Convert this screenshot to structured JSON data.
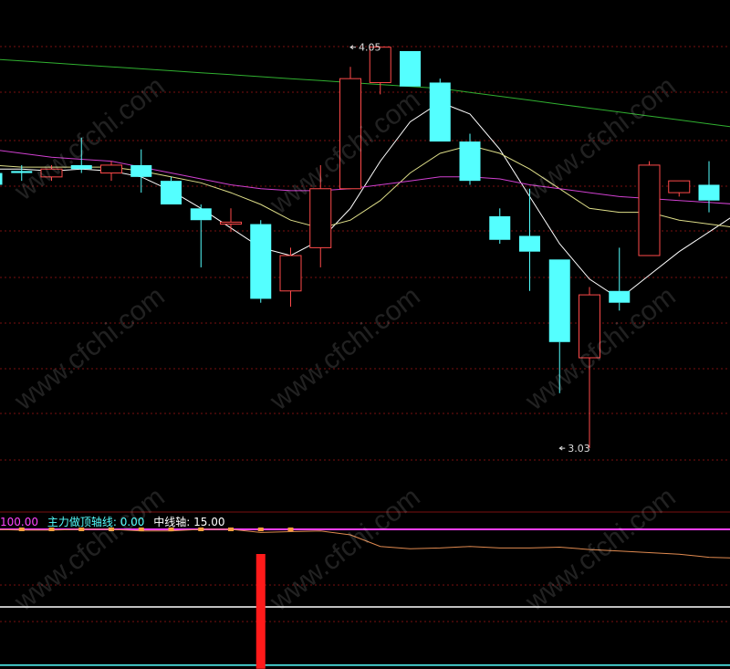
{
  "colors": {
    "background": "#000000",
    "grid": "#7a1010",
    "up_candle": "#ff4a4a",
    "down_candle": "#54ffff",
    "ma_white": "#ffffff",
    "ma_yellow": "#dddd88",
    "ma_magenta": "#d040d0",
    "ma_green": "#30b030",
    "legend_pink": "#ff44ff",
    "legend_cyan": "#54ffff",
    "legend_white": "#ffffff",
    "indicator_line": "#e08a50",
    "indicator_bar": "#ff1a1a",
    "indicator_dots": "#ffa040",
    "hline_magenta": "#ff40ff",
    "hline_white": "#ffffff",
    "hline_cyan": "#54ffff"
  },
  "watermarks": [
    "www.cfchi.com",
    "www.cfchi.com",
    "www.cfchi.com",
    "www.cfchi.com",
    "www.cfchi.com",
    "www.cfchi.com",
    "www.cfchi.com",
    "www.cfchi.com",
    "www.cfchi.com"
  ],
  "indicator_legend": {
    "first_value": "100.00",
    "top_axis_name": "主力做顶轴线:",
    "top_axis_value": "0.00",
    "mid_axis_name": "中线轴:",
    "mid_axis_value": "15.00"
  },
  "chart_data": [
    {
      "type": "candlestick",
      "ylim": [
        2.87,
        4.17
      ],
      "grid": true,
      "annotations": [
        {
          "text": "4.05",
          "bar_index": 12,
          "value": 4.05
        },
        {
          "text": "3.03",
          "bar_index": 19,
          "value": 3.03
        }
      ],
      "candles": [
        {
          "open": 3.73,
          "close": 3.7,
          "high": 3.74,
          "low": 3.69
        },
        {
          "open": 3.735,
          "close": 3.73,
          "high": 3.75,
          "low": 3.71
        },
        {
          "open": 3.72,
          "close": 3.74,
          "high": 3.75,
          "low": 3.71
        },
        {
          "open": 3.75,
          "close": 3.74,
          "high": 3.82,
          "low": 3.73
        },
        {
          "open": 3.73,
          "close": 3.75,
          "high": 3.76,
          "low": 3.71
        },
        {
          "open": 3.75,
          "close": 3.72,
          "high": 3.79,
          "low": 3.68
        },
        {
          "open": 3.71,
          "close": 3.65,
          "high": 3.72,
          "low": 3.65
        },
        {
          "open": 3.64,
          "close": 3.61,
          "high": 3.65,
          "low": 3.49
        },
        {
          "open": 3.6,
          "close": 3.605,
          "high": 3.64,
          "low": 3.58
        },
        {
          "open": 3.6,
          "close": 3.41,
          "high": 3.61,
          "low": 3.4
        },
        {
          "open": 3.43,
          "close": 3.52,
          "high": 3.54,
          "low": 3.39
        },
        {
          "open": 3.54,
          "close": 3.69,
          "high": 3.75,
          "low": 3.49
        },
        {
          "open": 3.69,
          "close": 3.97,
          "high": 4.0,
          "low": 3.69
        },
        {
          "open": 3.96,
          "close": 4.05,
          "high": 4.05,
          "low": 3.93
        },
        {
          "open": 4.04,
          "close": 3.95,
          "high": 4.04,
          "low": 3.95
        },
        {
          "open": 3.96,
          "close": 3.81,
          "high": 3.97,
          "low": 3.81
        },
        {
          "open": 3.81,
          "close": 3.71,
          "high": 3.83,
          "low": 3.7
        },
        {
          "open": 3.62,
          "close": 3.56,
          "high": 3.64,
          "low": 3.55
        },
        {
          "open": 3.57,
          "close": 3.53,
          "high": 3.69,
          "low": 3.43
        },
        {
          "open": 3.51,
          "close": 3.3,
          "high": 3.51,
          "low": 3.17
        },
        {
          "open": 3.26,
          "close": 3.42,
          "high": 3.44,
          "low": 3.03
        },
        {
          "open": 3.43,
          "close": 3.4,
          "high": 3.54,
          "low": 3.38
        },
        {
          "open": 3.52,
          "close": 3.75,
          "high": 3.76,
          "low": 3.52
        },
        {
          "open": 3.68,
          "close": 3.71,
          "high": 3.71,
          "low": 3.67
        },
        {
          "open": 3.7,
          "close": 3.66,
          "high": 3.76,
          "low": 3.63
        }
      ],
      "series": [
        {
          "values": [
            3.74,
            3.74,
            3.735,
            3.74,
            3.735,
            3.72,
            3.685,
            3.64,
            3.59,
            3.54,
            3.52,
            3.56,
            3.64,
            3.76,
            3.86,
            3.91,
            3.88,
            3.79,
            3.67,
            3.55,
            3.46,
            3.41,
            3.47,
            3.53,
            3.58
          ]
        },
        {
          "values": [
            3.75,
            3.745,
            3.745,
            3.745,
            3.745,
            3.735,
            3.72,
            3.705,
            3.68,
            3.65,
            3.61,
            3.59,
            3.61,
            3.66,
            3.73,
            3.78,
            3.8,
            3.78,
            3.74,
            3.69,
            3.64,
            3.63,
            3.63,
            3.61,
            3.6
          ]
        },
        {
          "values": [
            3.79,
            3.78,
            3.77,
            3.765,
            3.76,
            3.745,
            3.73,
            3.715,
            3.7,
            3.69,
            3.685,
            3.685,
            3.69,
            3.7,
            3.71,
            3.72,
            3.72,
            3.715,
            3.7,
            3.69,
            3.68,
            3.67,
            3.665,
            3.66,
            3.655
          ]
        },
        {
          "values": [
            4.02,
            4.015,
            4.01,
            4.005,
            4.0,
            3.995,
            3.99,
            3.985,
            3.98,
            3.975,
            3.97,
            3.965,
            3.96,
            3.955,
            3.95,
            3.945,
            3.935,
            3.925,
            3.915,
            3.905,
            3.895,
            3.885,
            3.875,
            3.865,
            3.855
          ]
        }
      ]
    },
    {
      "type": "line",
      "ylim": [
        -80,
        120
      ],
      "grid": true,
      "series": [
        {
          "values": [
            100,
            99,
            99,
            100,
            100,
            98,
            98,
            100,
            100,
            96,
            97,
            98,
            93,
            78,
            75,
            76,
            78,
            76,
            76,
            77,
            74,
            72,
            70,
            68,
            64
          ]
        }
      ],
      "bars": [
        {
          "bar_index": 9,
          "value": -75
        }
      ],
      "hlines": [
        {
          "value": 100
        },
        {
          "value": 0
        },
        {
          "value": -75
        }
      ]
    }
  ]
}
